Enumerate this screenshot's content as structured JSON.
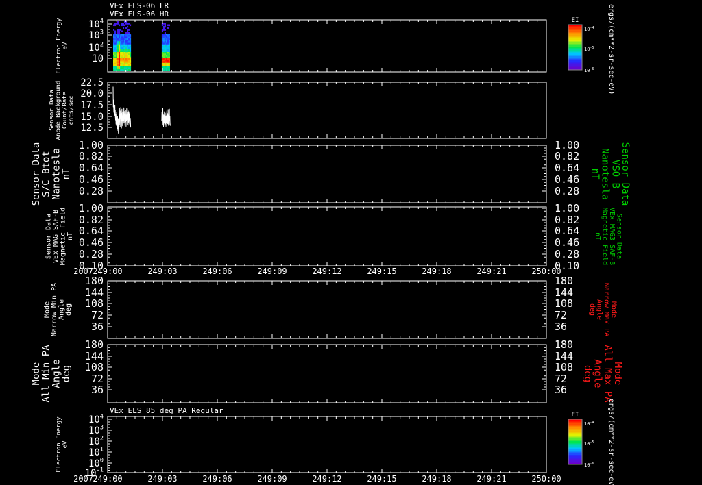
{
  "colors": {
    "background": "#000000",
    "axes": "#ffffff",
    "trace": "#ffffff",
    "green": "#00d000",
    "red": "#ff1a1a"
  },
  "time_axis": {
    "year": "2007",
    "ticks": [
      "249:00",
      "249:03",
      "249:06",
      "249:09",
      "249:12",
      "249:15",
      "249:18",
      "249:21",
      "250:00"
    ]
  },
  "chart_data": [
    {
      "id": "els-spectrogram",
      "type": "heatmap",
      "title_lines": [
        "VEx ELS-06 LR",
        "VEx ELS-06 HR"
      ],
      "ylabel_lines": [
        "Electron Energy",
        "eV"
      ],
      "yscale": "log",
      "yticks": [
        "10^4",
        "10^3",
        "10^2",
        "10"
      ],
      "colorbar": {
        "label": "EI",
        "units": "ergs/(cm**2-sr-sec-eV)",
        "ticks": [
          "10^-4",
          "10^-5",
          "10^-6"
        ]
      },
      "data_intervals": [
        [
          249.0125,
          249.0533
        ],
        [
          249.1233,
          249.1433
        ]
      ]
    },
    {
      "id": "anode-background",
      "type": "line",
      "ylabel_lines": [
        "Sensor Data",
        "Anode Background",
        "Count/Rate",
        "cnts/sec"
      ],
      "yticks": [
        "22.5",
        "20.0",
        "17.5",
        "15.0",
        "12.5"
      ],
      "ylim": [
        10.5,
        22.5
      ],
      "series": [
        {
          "x": [
            249.0125,
            249.013,
            249.0135,
            249.014,
            249.0145,
            249.015,
            249.0155,
            249.016,
            249.0165,
            249.017,
            249.0175,
            249.018,
            249.0185,
            249.019,
            249.0195,
            249.02,
            249.0205,
            249.021,
            249.0215,
            249.022,
            249.0225,
            249.023,
            249.0235,
            249.024,
            249.0245,
            249.025,
            249.0255,
            249.026,
            249.0265,
            249.027,
            249.0275,
            249.028,
            249.0285,
            249.029,
            249.0295,
            249.03,
            249.0305,
            249.031,
            249.0315,
            249.032,
            249.0325,
            249.033,
            249.0335,
            249.034,
            249.0345,
            249.035,
            249.0355,
            249.036,
            249.0365,
            249.037,
            249.0375,
            249.038,
            249.0385,
            249.039,
            249.0395,
            249.04,
            249.0405,
            249.041,
            249.0415,
            249.042,
            249.0425,
            249.043,
            249.0435,
            249.044,
            249.0445,
            249.045,
            249.0455,
            249.046,
            249.0465,
            249.047,
            249.0475,
            249.048,
            249.0485,
            249.049,
            249.0495,
            249.05,
            249.0505,
            249.051,
            249.0515,
            249.052,
            249.0525
          ],
          "y": [
            21.5,
            17.0,
            18.6,
            15.8,
            16.9,
            14.6,
            16.0,
            15.2,
            17.5,
            15.0,
            16.3,
            14.1,
            15.5,
            13.2,
            14.8,
            12.9,
            15.9,
            13.4,
            14.0,
            11.8,
            15.0,
            13.6,
            12.1,
            14.5,
            11.2,
            13.5,
            12.4,
            15.6,
            13.0,
            16.8,
            14.2,
            15.4,
            12.6,
            16.2,
            14.9,
            17.0,
            13.8,
            15.7,
            12.3,
            14.4,
            16.6,
            13.9,
            15.1,
            12.8,
            16.0,
            14.7,
            13.3,
            15.8,
            14.0,
            16.9,
            13.5,
            15.2,
            14.3,
            16.1,
            12.9,
            15.0,
            13.7,
            16.4,
            14.6,
            12.7,
            15.3,
            13.9,
            16.7,
            14.2,
            15.5,
            13.1,
            15.9,
            14.4,
            12.9,
            16.2,
            15.0,
            13.6,
            16.0,
            14.1,
            15.4,
            13.2,
            15.7,
            12.8,
            14.6,
            13.9,
            12.5
          ]
        },
        {
          "x": [
            249.1233,
            249.1238,
            249.1243,
            249.1248,
            249.1253,
            249.1258,
            249.1263,
            249.1268,
            249.1273,
            249.1278,
            249.1283,
            249.1288,
            249.1293,
            249.1298,
            249.1303,
            249.1308,
            249.1313,
            249.1318,
            249.1323,
            249.1328,
            249.1333,
            249.1338,
            249.1343,
            249.1348,
            249.1353,
            249.1358,
            249.1363,
            249.1368,
            249.1373,
            249.1378,
            249.1383,
            249.1388,
            249.1393,
            249.1398,
            249.1403,
            249.1408,
            249.1413,
            249.1418,
            249.1423,
            249.1428
          ],
          "y": [
            14.0,
            15.9,
            12.8,
            14.6,
            13.1,
            16.8,
            14.2,
            15.5,
            12.6,
            13.9,
            15.2,
            13.4,
            16.0,
            14.5,
            12.9,
            13.8,
            15.7,
            13.2,
            14.9,
            12.7,
            15.1,
            13.5,
            14.3,
            16.2,
            13.0,
            14.7,
            15.6,
            13.3,
            14.1,
            16.5,
            13.6,
            12.9,
            15.3,
            14.4,
            13.1,
            16.6,
            14.0,
            15.0,
            13.4,
            12.9
          ]
        }
      ]
    },
    {
      "id": "sc-btot",
      "type": "line",
      "ylabel_lines": [
        "Sensor Data",
        "S/C Btot",
        "Nanotesla",
        "nT"
      ],
      "ylabel_right_lines": [
        "Sensor Data",
        "VSO B",
        "Nanotesla",
        "nT"
      ],
      "yticks": [
        "1.00",
        "0.82",
        "0.64",
        "0.46",
        "0.28"
      ],
      "ylim": [
        0.1,
        1.0
      ],
      "series": []
    },
    {
      "id": "mag-field",
      "type": "line",
      "ylabel_lines": [
        "Sensor Data",
        "VEx MAG SAF-B",
        "Magnetic Field",
        "nT"
      ],
      "ylabel_right_lines": [
        "Sensor Data",
        "VEx MAG3 SAF-B",
        "Magnetic Field",
        "nT"
      ],
      "yticks": [
        "1.00",
        "0.82",
        "0.64",
        "0.46",
        "0.28",
        "0.10"
      ],
      "ylim": [
        0.1,
        1.0
      ],
      "series": []
    },
    {
      "id": "narrow-pa",
      "type": "line",
      "ylabel_lines": [
        "Mode",
        "Narrow Min PA",
        "Angle",
        "deg"
      ],
      "ylabel_right_lines": [
        "Mode",
        "Narrow Max PA",
        "Angle",
        "deg"
      ],
      "yticks": [
        "180",
        "144",
        "108",
        "72",
        "36"
      ],
      "ylim": [
        0,
        180
      ],
      "series": []
    },
    {
      "id": "all-pa",
      "type": "line",
      "ylabel_lines": [
        "Mode",
        "All Min PA",
        "Angle",
        "deg"
      ],
      "ylabel_right_lines": [
        "Mode",
        "All Max PA",
        "Angle",
        "deg"
      ],
      "yticks": [
        "180",
        "144",
        "108",
        "72",
        "36"
      ],
      "ylim": [
        0,
        180
      ],
      "series": []
    },
    {
      "id": "pa-85",
      "type": "heatmap",
      "title_lines": [
        "VEx ELS 85 deg PA Regular"
      ],
      "ylabel_lines": [
        "Electron Energy",
        "eV"
      ],
      "yscale": "log",
      "yticks": [
        "10^4",
        "10^3",
        "10^2",
        "10^1",
        "10^0",
        "10^-1"
      ],
      "colorbar": {
        "label": "EI",
        "units": "ergs/(cm**2-sr-sec-eV)",
        "ticks": [
          "10^-4",
          "10^-5",
          "10^-6"
        ]
      },
      "data_intervals": []
    }
  ]
}
